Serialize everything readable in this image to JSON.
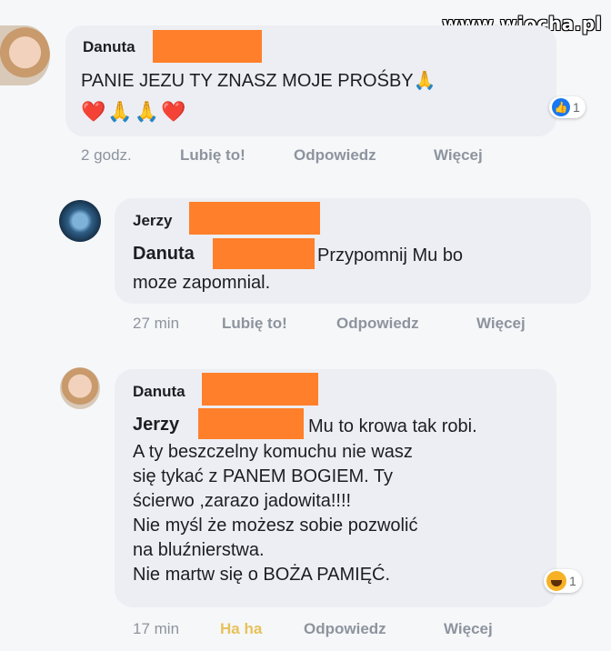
{
  "watermark": "www.wiocha.pl",
  "comments": [
    {
      "author": "Danuta",
      "text": "PANIE JEZU TY ZNASZ MOJE PROŚBY🙏",
      "emoji_line": "❤️🙏🙏❤️",
      "reaction_icon": "like-icon",
      "reaction_count": "1",
      "time": "2 godz.",
      "like": "Lubię to!",
      "reply": "Odpowiedz",
      "more": "Więcej"
    },
    {
      "author": "Jerzy",
      "mention": "Danuta",
      "text_after_mention": "Przypomnij Mu bo",
      "text": "moze zapomnial.",
      "time": "27 min",
      "like": "Lubię to!",
      "reply": "Odpowiedz",
      "more": "Więcej"
    },
    {
      "author": "Danuta",
      "mention": "Jerzy",
      "text_after_mention": "Mu to krowa tak robi.",
      "text": "A ty beszczelny komuchu nie wasz\nsię tykać z PANEM BOGIEM. Ty\nścierwo ,zarazo jadowita!!!!\nNie myśl że możesz sobie pozwolić\nna bluźnierstwa.\nNie martw się o BOŻA PAMIĘĆ.",
      "reaction_icon": "haha-icon",
      "reaction_count": "1",
      "time": "17 min",
      "like": "Ha ha",
      "reply": "Odpowiedz",
      "more": "Więcej"
    }
  ],
  "colors": {
    "redaction": "#ff7f2a",
    "bubble": "#eceef3",
    "haha_active": "#e7c15a"
  }
}
